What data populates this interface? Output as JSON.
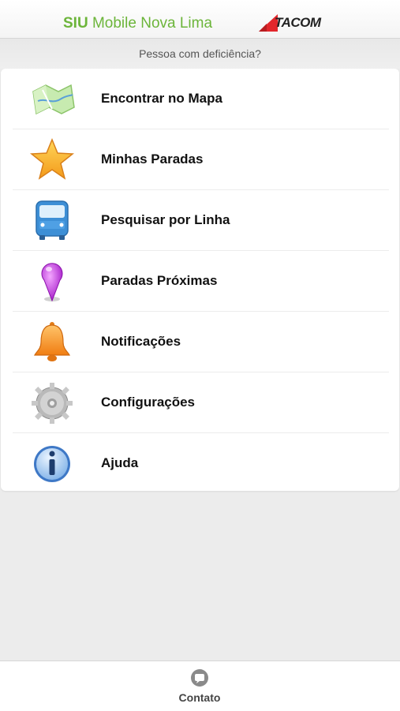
{
  "header": {
    "title_strong": "SIU",
    "title_rest": "Mobile Nova Lima",
    "brand": "TACOM",
    "brand_color": "#e2262b"
  },
  "subheader": {
    "link": "Pessoa com deficiência?"
  },
  "menu": {
    "items": [
      {
        "label": "Encontrar no Mapa",
        "icon": "map-icon"
      },
      {
        "label": "Minhas Paradas",
        "icon": "star-icon"
      },
      {
        "label": "Pesquisar por Linha",
        "icon": "bus-icon"
      },
      {
        "label": "Paradas Próximas",
        "icon": "location-pin-icon"
      },
      {
        "label": "Notificações",
        "icon": "bell-icon"
      },
      {
        "label": "Configurações",
        "icon": "gear-icon"
      },
      {
        "label": "Ajuda",
        "icon": "info-icon"
      }
    ]
  },
  "footer": {
    "contact_label": "Contato",
    "contact_icon": "chat-bubble-icon"
  },
  "colors": {
    "accent_green": "#6cb53a",
    "background": "#ececec"
  }
}
